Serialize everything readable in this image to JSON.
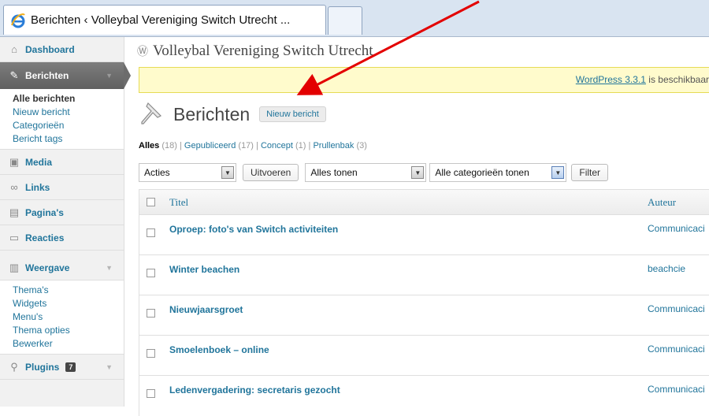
{
  "browser": {
    "tab_title": "Berichten ‹ Volleybal Vereniging Switch Utrecht ..."
  },
  "sidebar": {
    "items": [
      {
        "label": "Dashboard",
        "icon": "home-icon"
      },
      {
        "label": "Berichten",
        "icon": "pin-icon"
      },
      {
        "label": "Media",
        "icon": "media-icon"
      },
      {
        "label": "Links",
        "icon": "link-icon"
      },
      {
        "label": "Pagina's",
        "icon": "page-icon"
      },
      {
        "label": "Reacties",
        "icon": "comment-icon"
      },
      {
        "label": "Weergave",
        "icon": "appearance-icon"
      },
      {
        "label": "Plugins",
        "icon": "plug-icon",
        "badge": "7"
      }
    ],
    "berichten_sub": [
      "Alle berichten",
      "Nieuw bericht",
      "Categorieën",
      "Bericht tags"
    ],
    "weergave_sub": [
      "Thema's",
      "Widgets",
      "Menu's",
      "Thema opties",
      "Bewerker"
    ]
  },
  "header": {
    "site_title": "Volleybal Vereniging Switch Utrecht"
  },
  "notice": {
    "link": "WordPress 3.3.1",
    "text": " is beschikbaar"
  },
  "page": {
    "title": "Berichten",
    "add_new": "Nieuw bericht"
  },
  "filters": {
    "all": "Alles",
    "all_count": "(18)",
    "published": "Gepubliceerd",
    "published_count": "(17)",
    "draft": "Concept",
    "draft_count": "(1)",
    "trash": "Prullenbak",
    "trash_count": "(3)",
    "separator": " | "
  },
  "tablenav": {
    "bulk_actions": "Acties",
    "apply": "Uitvoeren",
    "dates": "Alles tonen",
    "categories": "Alle categorieën tonen",
    "filter": "Filter"
  },
  "table": {
    "col_title": "Titel",
    "col_author": "Auteur",
    "rows": [
      {
        "title": "Oproep: foto's van Switch activiteiten",
        "author": "Communicaci"
      },
      {
        "title": "Winter beachen",
        "author": "beachcie"
      },
      {
        "title": "Nieuwjaarsgroet",
        "author": "Communicaci"
      },
      {
        "title": "Smoelenboek – online",
        "author": "Communicaci"
      },
      {
        "title": "Ledenvergadering: secretaris gezocht",
        "author": "Communicaci"
      }
    ]
  },
  "colors": {
    "link": "#21759b",
    "notice_bg": "#fffbcc",
    "annotation_arrow": "#e30000"
  }
}
